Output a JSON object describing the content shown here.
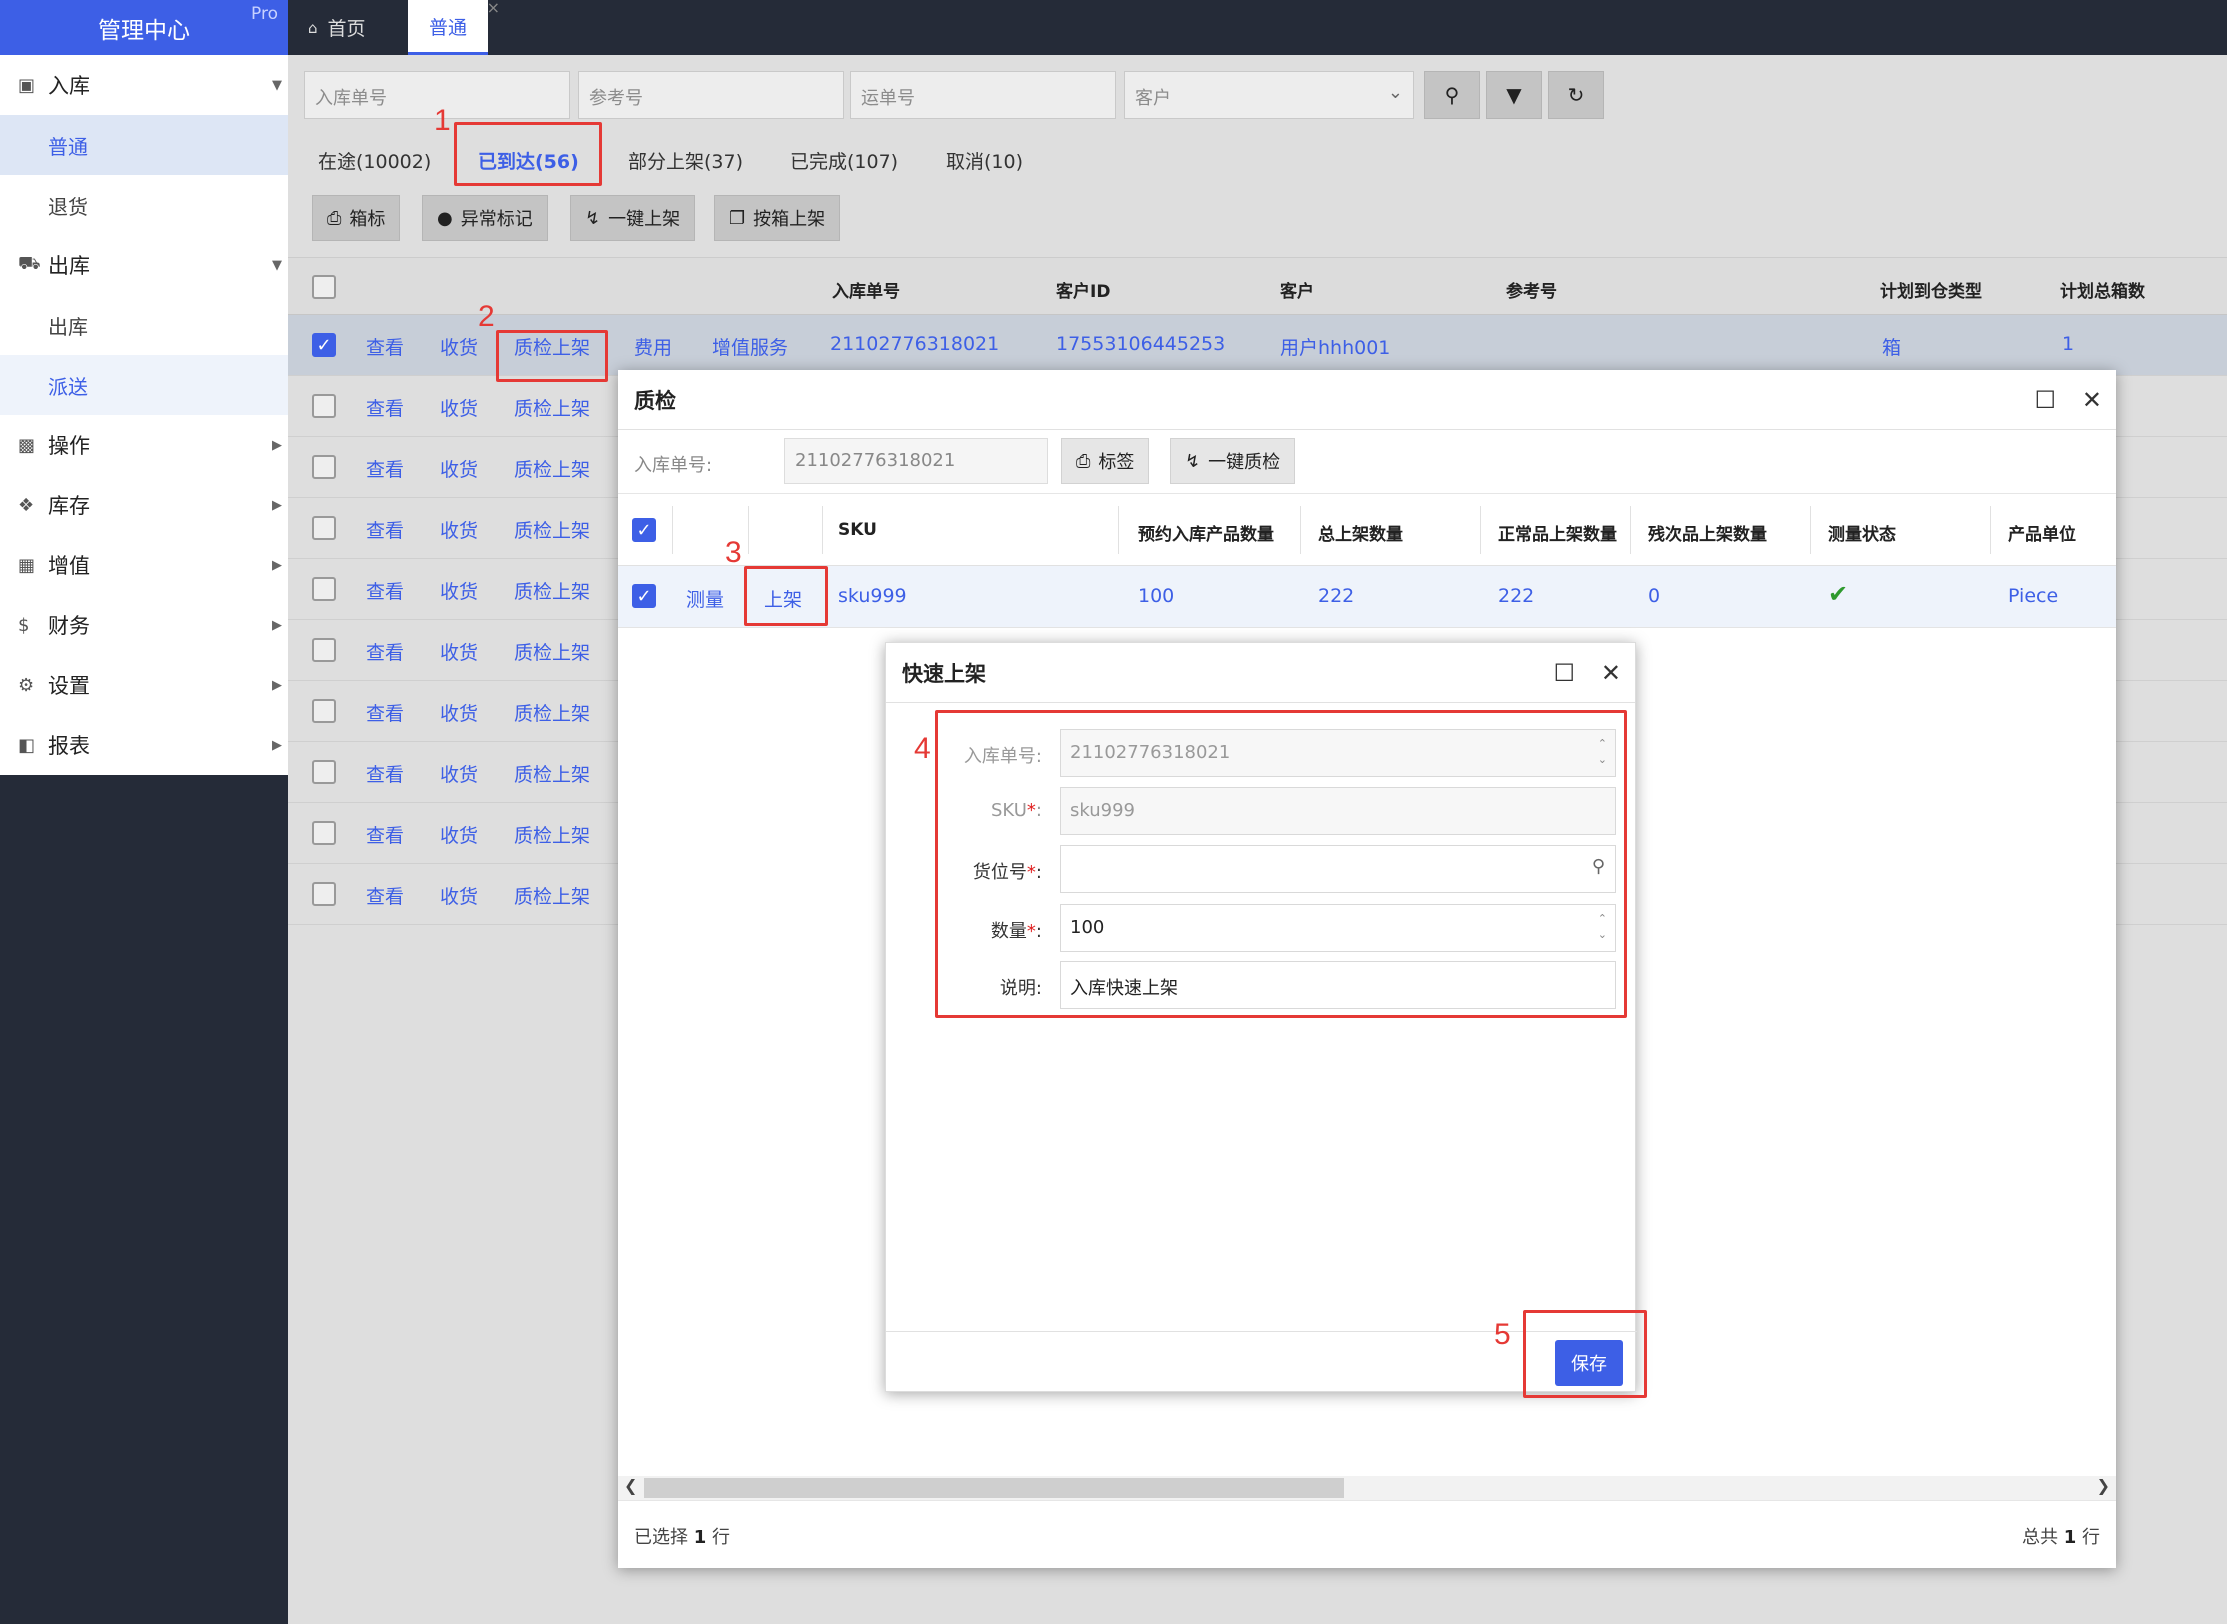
{
  "sidebar": {
    "logo": "管理中心",
    "badge": "Pro",
    "groups": [
      {
        "label": "入库",
        "icon": "inbox-icon",
        "items": [
          "普通",
          "退货"
        ]
      },
      {
        "label": "出库",
        "icon": "truck-icon",
        "items": [
          "出库",
          "派送"
        ]
      },
      {
        "label": "操作",
        "icon": "briefcase-icon"
      },
      {
        "label": "库存",
        "icon": "cubes-icon"
      },
      {
        "label": "增值",
        "icon": "grid-icon"
      },
      {
        "label": "财务",
        "icon": "dollar-icon"
      },
      {
        "label": "设置",
        "icon": "gears-icon"
      },
      {
        "label": "报表",
        "icon": "bar-chart-icon"
      }
    ]
  },
  "topbar": {
    "home": "首页",
    "current": "普通"
  },
  "search": {
    "inbound_no": "入库单号",
    "ref_no": "参考号",
    "waybill_no": "运单号",
    "customer": "客户"
  },
  "status_tabs": [
    "在途(10002)",
    "已到达(56)",
    "部分上架(37)",
    "已完成(107)",
    "取消(10)"
  ],
  "actions": [
    "箱标",
    "异常标记",
    "一键上架",
    "按箱上架"
  ],
  "grid": {
    "headers": [
      "入库单号",
      "客户ID",
      "客户",
      "参考号",
      "计划到仓类型",
      "计划总箱数"
    ],
    "row_links": [
      "查看",
      "收货",
      "质检上架"
    ],
    "selected_row": {
      "fee": "费用",
      "value_added": "增值服务",
      "inbound_no": "21102776318021",
      "customer_id": "17553106445253",
      "customer": "用户hhh001",
      "type": "箱",
      "boxes": "1"
    }
  },
  "qc_modal": {
    "title": "质检",
    "inbound_label": "入库单号:",
    "inbound_value": "21102776318021",
    "label_btn": "标签",
    "oneclick_btn": "一键质检",
    "headers": [
      "SKU",
      "预约入库产品数量",
      "总上架数量",
      "正常品上架数量",
      "残次品上架数量",
      "测量状态",
      "产品单位"
    ],
    "row": {
      "measure": "测量",
      "shelve": "上架",
      "sku": "sku999",
      "planned": "100",
      "total": "222",
      "normal": "222",
      "defect": "0",
      "unit": "Piece"
    },
    "footer_selected_prefix": "已选择",
    "footer_selected_count": "1",
    "footer_selected_suffix": "行",
    "footer_total_prefix": "总共",
    "footer_total_count": "1",
    "footer_total_suffix": "行"
  },
  "quick_modal": {
    "title": "快速上架",
    "fields": {
      "inbound_label": "入库单号:",
      "inbound_value": "21102776318021",
      "sku_label": "SKU",
      "sku_value": "sku999",
      "location_label": "货位号",
      "location_value": "",
      "qty_label": "数量",
      "qty_value": "100",
      "note_label": "说明:",
      "note_value": "入库快速上架"
    },
    "save": "保存"
  },
  "annotations": [
    "1",
    "2",
    "3",
    "4",
    "5"
  ],
  "colors": {
    "primary": "#3d5fe6",
    "annotation": "#e53935",
    "sidebar_bg": "#252b38"
  }
}
